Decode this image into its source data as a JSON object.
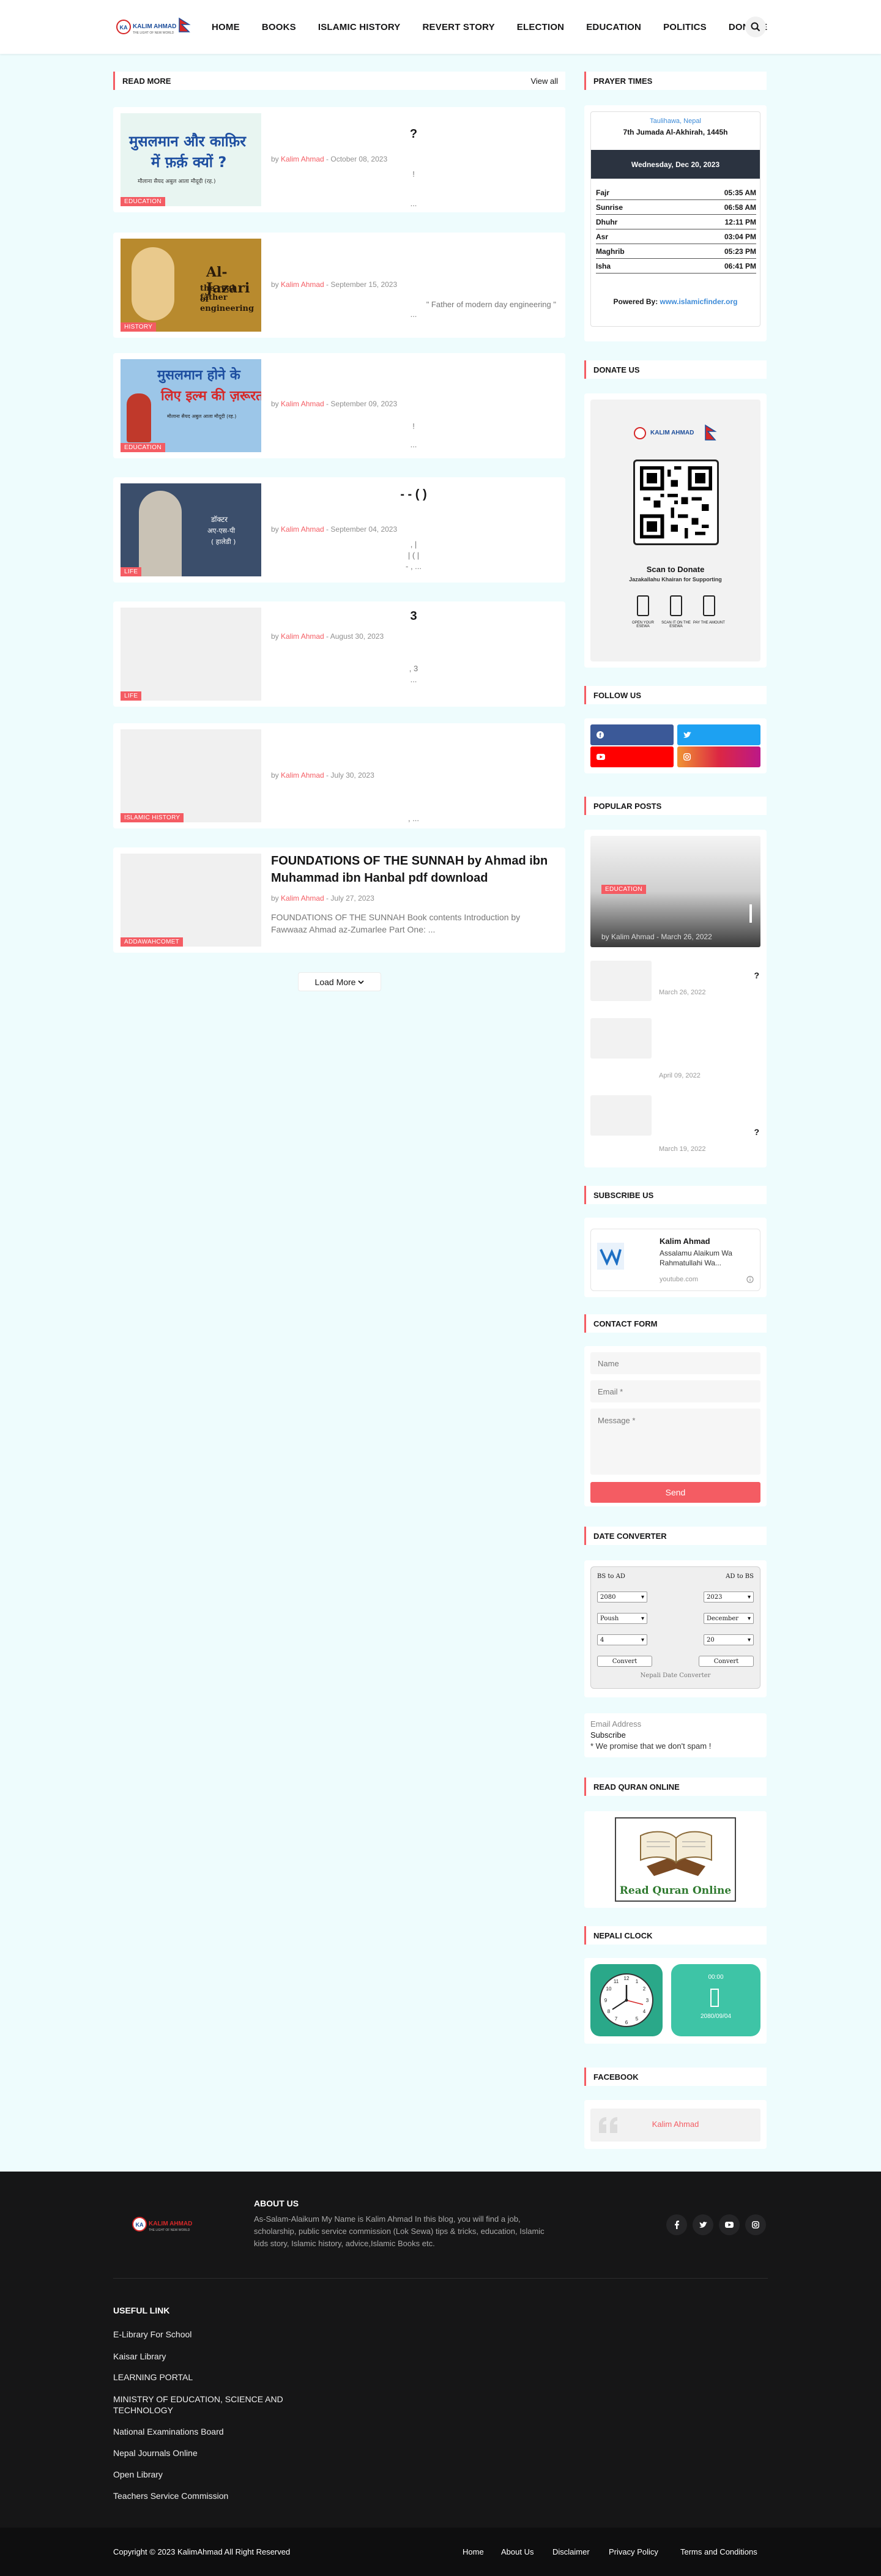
{
  "header": {
    "logo_text": "KALIM AHMAD",
    "logo_sub": "THE LIGHT OF NEW WORLD",
    "nav": [
      "HOME",
      "BOOKS",
      "ISLAMIC HISTORY",
      "REVERT STORY",
      "ELECTION",
      "EDUCATION",
      "POLITICS",
      "DONATE"
    ]
  },
  "main": {
    "section_title": "READ MORE",
    "view_all": "View all",
    "posts": [
      {
        "title": "?",
        "author": "Kalim Ahmad",
        "date": "October 08, 2023",
        "category": "EDUCATION",
        "snippet": "!",
        "snippet2": "...",
        "thumb_line1": "मुसलमान और काफ़िर",
        "thumb_line2": "में फ़र्क़ क्यों ?",
        "thumb_line3": "मौलाना सैयद अबुल आला मौदूदी (रह.)"
      },
      {
        "title": "",
        "author": "Kalim Ahmad",
        "date": "September 15, 2023",
        "category": "HISTORY",
        "snippet": "\" Father of modern day engineering \"",
        "snippet2": "...",
        "thumb_line1": "Al-Jazari",
        "thumb_line2": "the real father",
        "thumb_line3": "of engineering"
      },
      {
        "title": "",
        "author": "Kalim Ahmad",
        "date": "September 09, 2023",
        "category": "EDUCATION",
        "snippet": "!",
        "snippet2": "...",
        "thumb_line1": "मुसलमान होने के",
        "thumb_line2": "लिए इल्म की ज़रूरत",
        "thumb_line3": "मौलाना सैयद अबुल आला मौदूदी (रह.)"
      },
      {
        "title": "-   -   (   )",
        "author": "Kalim Ahmad",
        "date": "September 04, 2023",
        "category": "LIFE",
        "snippet": ",   |",
        "snippet2": "|   (   |",
        "snippet3": "-   ,   ...",
        "thumb_line1": "डॉक्टर",
        "thumb_line2": "अए-एस-पी",
        "thumb_line3": "( हालेडी )"
      },
      {
        "title": "3",
        "author": "Kalim Ahmad",
        "date": "August 30, 2023",
        "category": "LIFE",
        "snippet": ",   3",
        "snippet2": "..."
      },
      {
        "title": "",
        "author": "Kalim Ahmad",
        "date": "July 30, 2023",
        "category": "ISLAMIC HISTORY",
        "snippet": ",   ..."
      },
      {
        "title": "FOUNDATIONS OF THE SUNNAH by Ahmad ibn Muhammad ibn Hanbal pdf download",
        "author": "Kalim Ahmad",
        "date": "July 27, 2023",
        "category": "ADDAWAHCOMET",
        "snippet": "FOUNDATIONS OF THE SUNNAH  Book contents  Introduction by Fawwaaz Ahmad az-Zumarlee Part One: ..."
      }
    ],
    "load_more": "Load More"
  },
  "sidebar": {
    "prayer": {
      "title": "PRAYER TIMES",
      "location": "Taulihawa, Nepal",
      "hijri": "7th Jumada Al-Akhirah, 1445h",
      "date": "Wednesday, Dec 20, 2023",
      "times": [
        {
          "name": "Fajr",
          "time": "05:35 AM"
        },
        {
          "name": "Sunrise",
          "time": "06:58 AM"
        },
        {
          "name": "Dhuhr",
          "time": "12:11 PM"
        },
        {
          "name": "Asr",
          "time": "03:04 PM"
        },
        {
          "name": "Maghrib",
          "time": "05:23 PM"
        },
        {
          "name": "Isha",
          "time": "06:41 PM"
        }
      ],
      "powered_label": "Powered By:",
      "powered_link": "www.islamicfinder.org"
    },
    "donate": {
      "title": "DONATE US",
      "scan": "Scan to Donate",
      "sub": "Jazakallahu Khairan for Supporting",
      "step1": "OPEN YOUR ESEWA",
      "step2": "SCAN IT ON THE ESEWA",
      "step3": "PAY THE AMOUNT",
      "logo": "KALIM AHMAD"
    },
    "follow": {
      "title": "FOLLOW US"
    },
    "popular": {
      "title": "POPULAR POSTS",
      "featured": {
        "category": "EDUCATION",
        "author": "Kalim Ahmad",
        "date": "March 26, 2022"
      },
      "items": [
        {
          "title": "?",
          "date": "March 26, 2022"
        },
        {
          "title": "",
          "date": "April 09, 2022"
        },
        {
          "title": "?",
          "date": "March 19, 2022"
        }
      ]
    },
    "subscribe": {
      "title": "SUBSCRIBE US",
      "channel": "Kalim Ahmad",
      "desc1": "Assalamu Alaikum Wa",
      "desc2": "Rahmatullahi Wa...",
      "source": "youtube.com"
    },
    "contact": {
      "title": "CONTACT FORM",
      "name_ph": "Name",
      "email_ph": "Email *",
      "message_ph": "Message *",
      "send": "Send"
    },
    "date_converter": {
      "title": "DATE CONVERTER",
      "left_label": "BS to AD",
      "right_label": "AD to BS",
      "bs_year": "2080",
      "bs_month": "Poush",
      "bs_day": "4",
      "ad_year": "2023",
      "ad_month": "December",
      "ad_day": "20",
      "convert": "Convert",
      "footer": "Nepali Date Converter"
    },
    "newsletter": {
      "email_label": "Email Address",
      "subscribe": "Subscribe",
      "note": "* We promise that we don't spam !"
    },
    "quran": {
      "title": "READ QURAN ONLINE",
      "label": "Read Quran Online"
    },
    "clock": {
      "title": "NEPALI CLOCK",
      "time": "00:00",
      "date": "2080/09/04"
    },
    "facebook": {
      "title": "FACEBOOK",
      "name": "Kalim Ahmad"
    }
  },
  "footer": {
    "about_title": "ABOUT US",
    "about_text": "As-Salam-Alaikum My Name is Kalim Ahmad In this blog, you will find a job, scholarship, public service commission (Lok Sewa) tips & tricks, education, Islamic kids story, Islamic history, advice,Islamic Books etc.",
    "useful_title": "USEFUL LINK",
    "links": [
      "E-Library For School",
      "Kaisar Library",
      "LEARNING PORTAL",
      "MINISTRY OF EDUCATION, SCIENCE AND TECHNOLOGY",
      "National Examinations Board",
      "Nepal Journals Online",
      "Open Library",
      "Teachers Service Commission"
    ],
    "copyright": "Copyright © 2023 KalimAhmad All Right Reserved",
    "bottom_links": [
      "Home",
      "About Us",
      "Disclaimer",
      "Privacy Policy",
      "Terms and Conditions"
    ]
  },
  "colors": {
    "accent": "#f45c63",
    "background": "#eefcfd",
    "dark": "#161617",
    "facebook": "#3b5998",
    "twitter": "#1da1f2",
    "youtube": "#ff0000",
    "instagram": "#c13584"
  }
}
